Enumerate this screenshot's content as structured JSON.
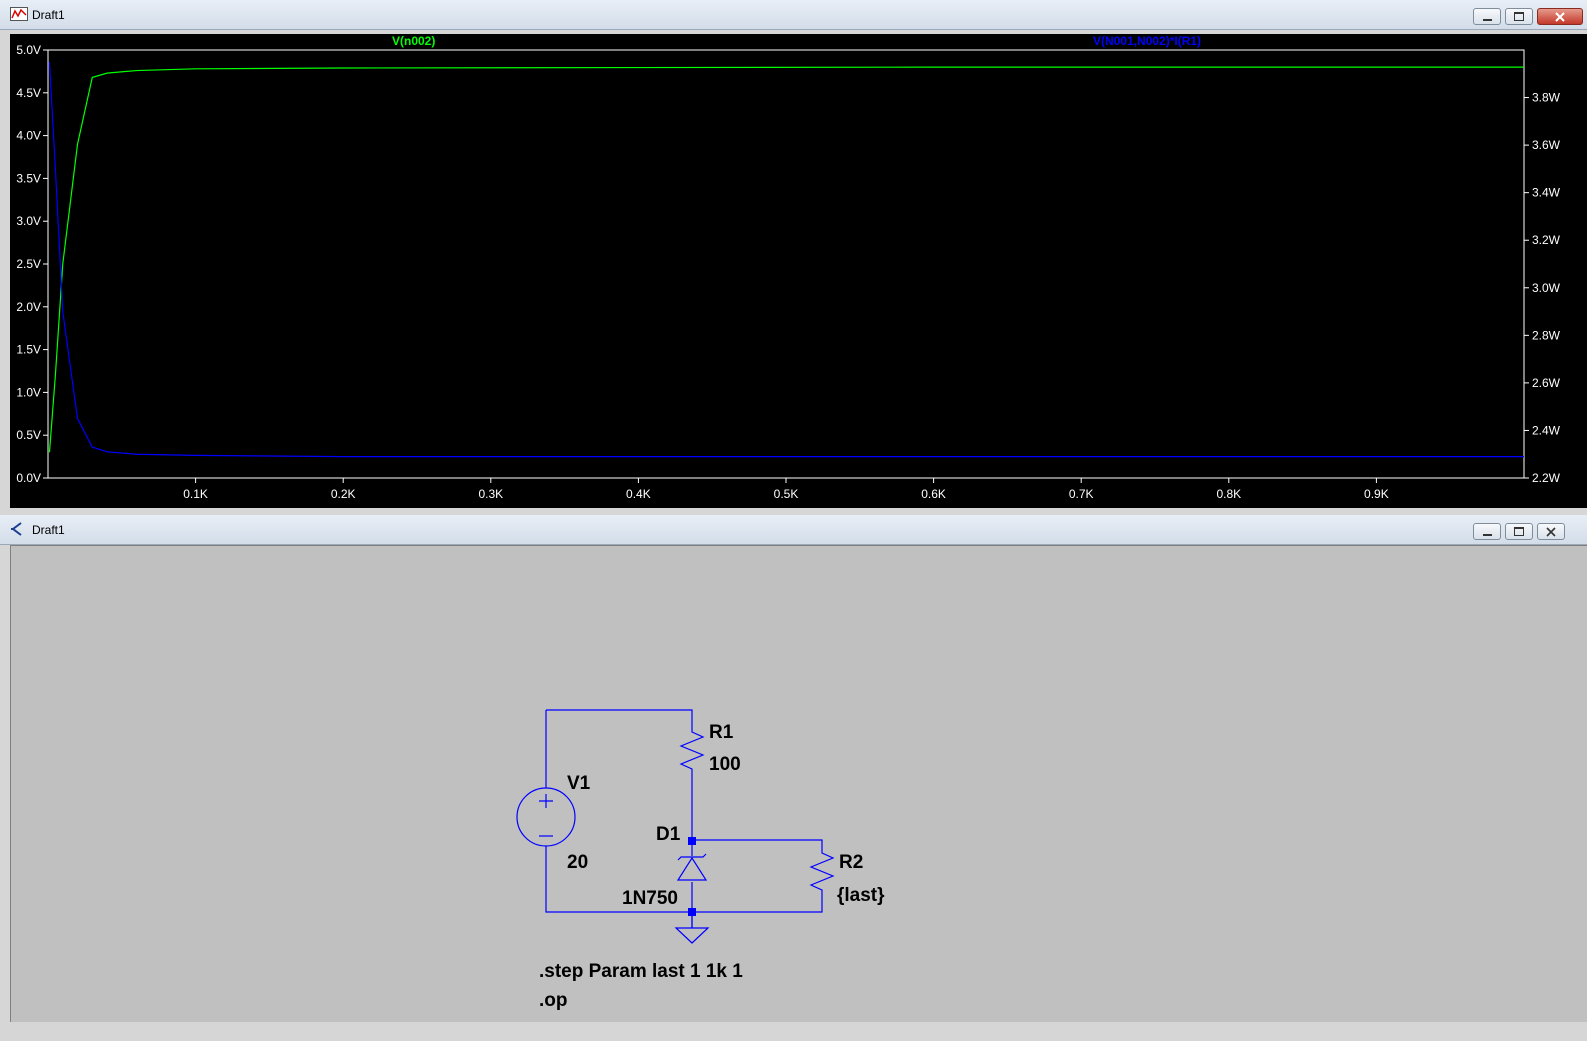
{
  "waveform_window": {
    "title": "Draft1",
    "trace_labels": [
      "V(n002)",
      "V(N001,N002)*I(R1)"
    ],
    "colors": {
      "trace1": "#00ff00",
      "trace2": "#0000ff",
      "axis": "#ffffff",
      "background": "#000000"
    }
  },
  "schematic_window": {
    "title": "Draft1",
    "components": {
      "v1_name": "V1",
      "v1_value": "20",
      "r1_name": "R1",
      "r1_value": "100",
      "d1_name": "D1",
      "d1_value": "1N750",
      "r2_name": "R2",
      "r2_value": "{last}"
    },
    "directives": [
      ".step Param last 1 1k 1",
      ".op"
    ],
    "colors": {
      "wire": "#0000ff",
      "background": "#c0c0c0"
    }
  },
  "chart_data": {
    "type": "line",
    "x": [
      1,
      5,
      10,
      20,
      30,
      40,
      60,
      100,
      200,
      400,
      600,
      800,
      1000
    ],
    "series": [
      {
        "name": "V(n002)",
        "axis": "left",
        "values": [
          0.3,
          1.2,
          2.5,
          3.9,
          4.68,
          4.73,
          4.76,
          4.78,
          4.79,
          4.795,
          4.8,
          4.8,
          4.8
        ]
      },
      {
        "name": "V(N001,N002)*I(R1)",
        "axis": "right",
        "values": [
          3.95,
          3.5,
          2.9,
          2.45,
          2.33,
          2.31,
          2.3,
          2.295,
          2.29,
          2.29,
          2.29,
          2.29,
          2.29
        ]
      }
    ],
    "xlim": [
      0,
      1000
    ],
    "ylim_left": [
      0,
      5
    ],
    "ylim_right": [
      2.2,
      4.0
    ],
    "x_ticks": [
      "0.1K",
      "0.2K",
      "0.3K",
      "0.4K",
      "0.5K",
      "0.6K",
      "0.7K",
      "0.8K",
      "0.9K"
    ],
    "y_left_ticks": [
      "0.0V",
      "0.5V",
      "1.0V",
      "1.5V",
      "2.0V",
      "2.5V",
      "3.0V",
      "3.5V",
      "4.0V",
      "4.5V",
      "5.0V"
    ],
    "y_right_ticks": [
      "2.2W",
      "2.4W",
      "2.6W",
      "2.8W",
      "3.0W",
      "3.2W",
      "3.4W",
      "3.6W",
      "3.8W"
    ],
    "grid": false
  }
}
